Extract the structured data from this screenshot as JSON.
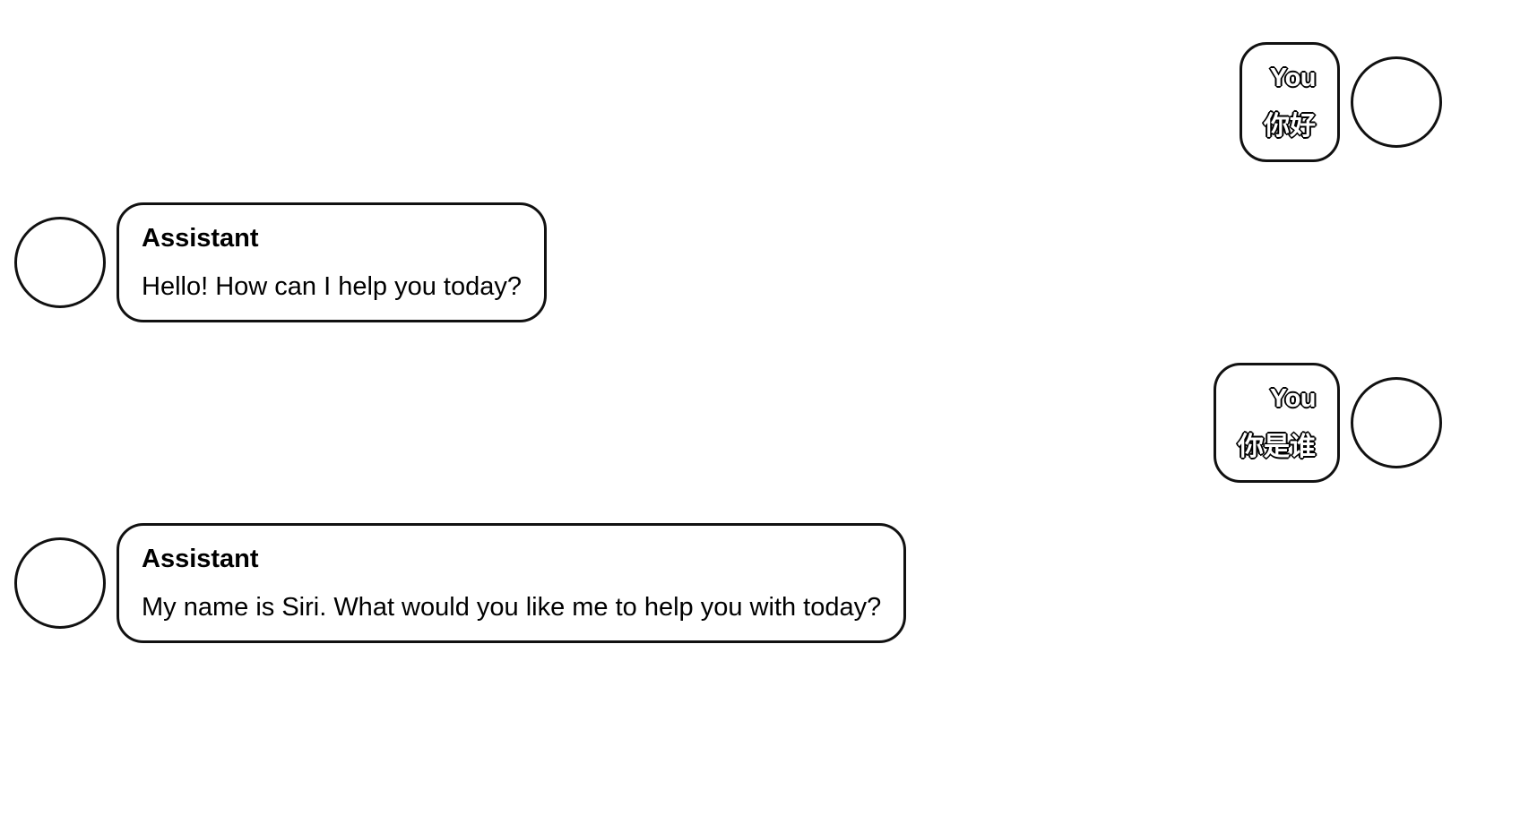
{
  "messages": [
    {
      "role": "user",
      "sender": "You",
      "text": "你好"
    },
    {
      "role": "assistant",
      "sender": "Assistant",
      "text": "Hello! How can I help you today?"
    },
    {
      "role": "user",
      "sender": "You",
      "text": "你是谁"
    },
    {
      "role": "assistant",
      "sender": "Assistant",
      "text": "My name is Siri. What would you like me to help you with today?"
    }
  ]
}
